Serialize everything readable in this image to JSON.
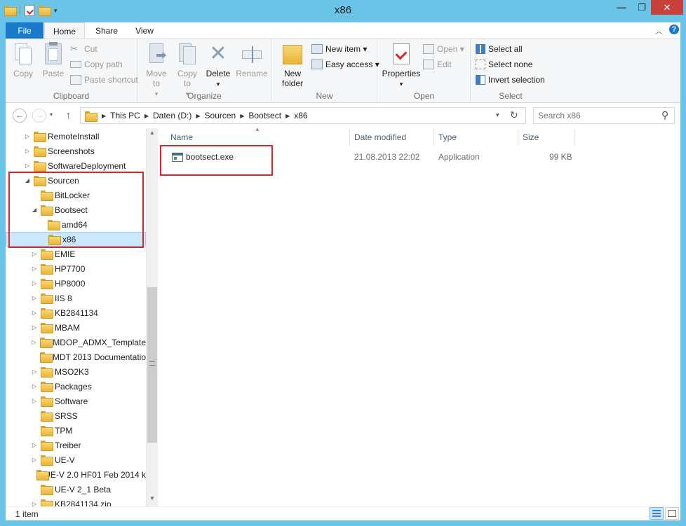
{
  "window": {
    "title": "x86",
    "min_glyph": "—",
    "max_glyph": "❐",
    "close_glyph": "✕"
  },
  "tabs": {
    "file": "File",
    "home": "Home",
    "share": "Share",
    "view": "View"
  },
  "ribbon": {
    "clipboard": {
      "label": "Clipboard",
      "copy": "Copy",
      "paste": "Paste",
      "cut": "Cut",
      "copy_path": "Copy path",
      "paste_shortcut": "Paste shortcut"
    },
    "organize": {
      "label": "Organize",
      "move_to": "Move to",
      "copy_to": "Copy to",
      "delete": "Delete",
      "rename": "Rename"
    },
    "new": {
      "label": "New",
      "new_folder_1": "New",
      "new_folder_2": "folder",
      "new_item": "New item ▾",
      "easy_access": "Easy access ▾"
    },
    "open": {
      "label": "Open",
      "properties": "Properties",
      "open": "Open ▾",
      "edit": "Edit"
    },
    "select": {
      "label": "Select",
      "select_all": "Select all",
      "select_none": "Select none",
      "invert_selection": "Invert selection"
    }
  },
  "address": {
    "crumbs": [
      "This PC",
      "Daten (D:)",
      "Sourcen",
      "Bootsect",
      "x86"
    ],
    "search_placeholder": "Search x86"
  },
  "tree": [
    {
      "label": "RemoteInstall",
      "indent": 0,
      "arrow": "▷"
    },
    {
      "label": "Screenshots",
      "indent": 0,
      "arrow": "▷"
    },
    {
      "label": "SoftwareDeployment",
      "indent": 0,
      "arrow": "▷"
    },
    {
      "label": "Sourcen",
      "indent": 0,
      "arrow": "◢"
    },
    {
      "label": "BitLocker",
      "indent": 1,
      "arrow": ""
    },
    {
      "label": "Bootsect",
      "indent": 1,
      "arrow": "◢"
    },
    {
      "label": "amd64",
      "indent": 2,
      "arrow": ""
    },
    {
      "label": "x86",
      "indent": 2,
      "arrow": "",
      "selected": true
    },
    {
      "label": "EMIE",
      "indent": 1,
      "arrow": "▷"
    },
    {
      "label": "HP7700",
      "indent": 1,
      "arrow": "▷"
    },
    {
      "label": "HP8000",
      "indent": 1,
      "arrow": "▷"
    },
    {
      "label": "IIS 8",
      "indent": 1,
      "arrow": "▷"
    },
    {
      "label": "KB2841134",
      "indent": 1,
      "arrow": "▷"
    },
    {
      "label": "MBAM",
      "indent": 1,
      "arrow": "▷"
    },
    {
      "label": "MDOP_ADMX_Template",
      "indent": 1,
      "arrow": "▷"
    },
    {
      "label": "MDT 2013 Documentatio",
      "indent": 1,
      "arrow": ""
    },
    {
      "label": "MSO2K3",
      "indent": 1,
      "arrow": "▷"
    },
    {
      "label": "Packages",
      "indent": 1,
      "arrow": "▷"
    },
    {
      "label": "Software",
      "indent": 1,
      "arrow": "▷"
    },
    {
      "label": "SRSS",
      "indent": 1,
      "arrow": ""
    },
    {
      "label": "TPM",
      "indent": 1,
      "arrow": ""
    },
    {
      "label": "Treiber",
      "indent": 1,
      "arrow": "▷"
    },
    {
      "label": "UE-V",
      "indent": 1,
      "arrow": "▷"
    },
    {
      "label": "UE-V 2.0 HF01 Feb 2014 k",
      "indent": 1,
      "arrow": ""
    },
    {
      "label": "UE-V 2_1 Beta",
      "indent": 1,
      "arrow": ""
    },
    {
      "label": "KB2841134.zip",
      "indent": 1,
      "arrow": "▷"
    }
  ],
  "columns": {
    "name": "Name",
    "date": "Date modified",
    "type": "Type",
    "size": "Size"
  },
  "files": [
    {
      "name": "bootsect.exe",
      "date": "21.08.2013 22:02",
      "type": "Application",
      "size": "99 KB"
    }
  ],
  "status": {
    "count": "1 item"
  }
}
